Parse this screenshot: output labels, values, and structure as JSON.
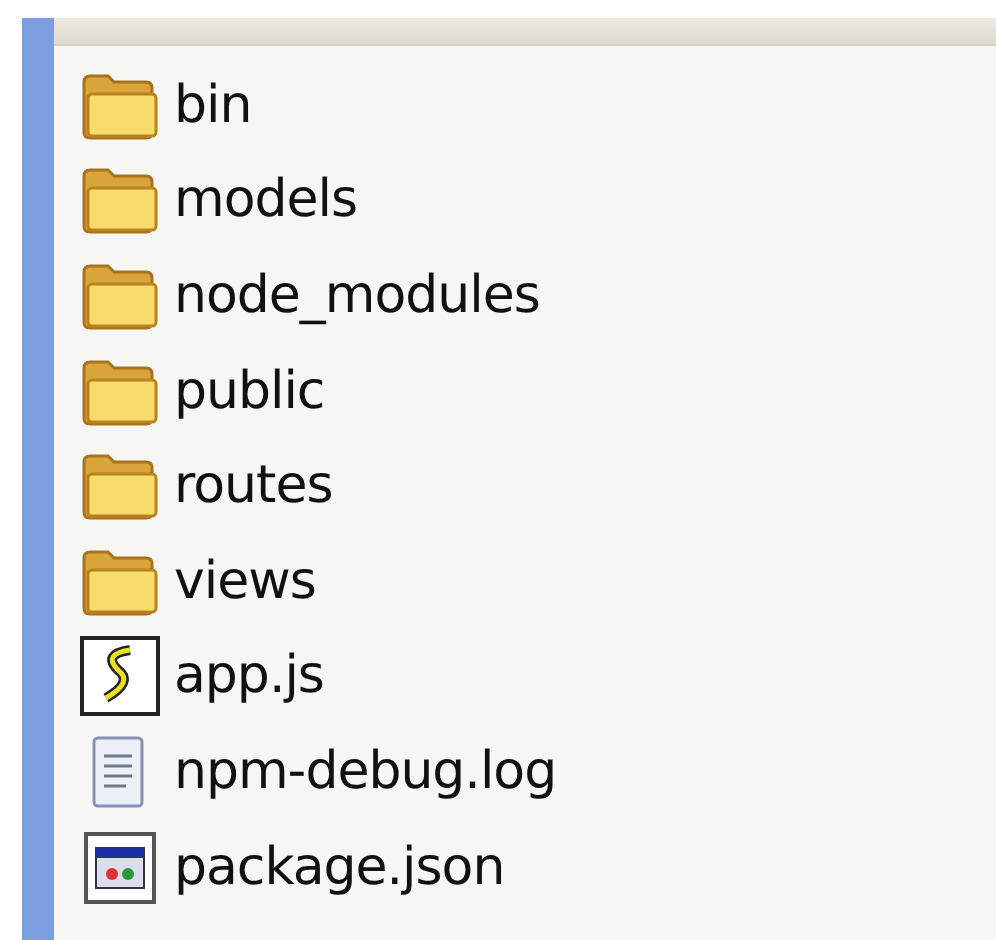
{
  "files": [
    {
      "name": "bin",
      "kind": "folder"
    },
    {
      "name": "models",
      "kind": "folder"
    },
    {
      "name": "node_modules",
      "kind": "folder"
    },
    {
      "name": "public",
      "kind": "folder"
    },
    {
      "name": "routes",
      "kind": "folder"
    },
    {
      "name": "views",
      "kind": "folder"
    },
    {
      "name": "app.js",
      "kind": "script"
    },
    {
      "name": "npm-debug.log",
      "kind": "text"
    },
    {
      "name": "package.json",
      "kind": "app"
    }
  ]
}
